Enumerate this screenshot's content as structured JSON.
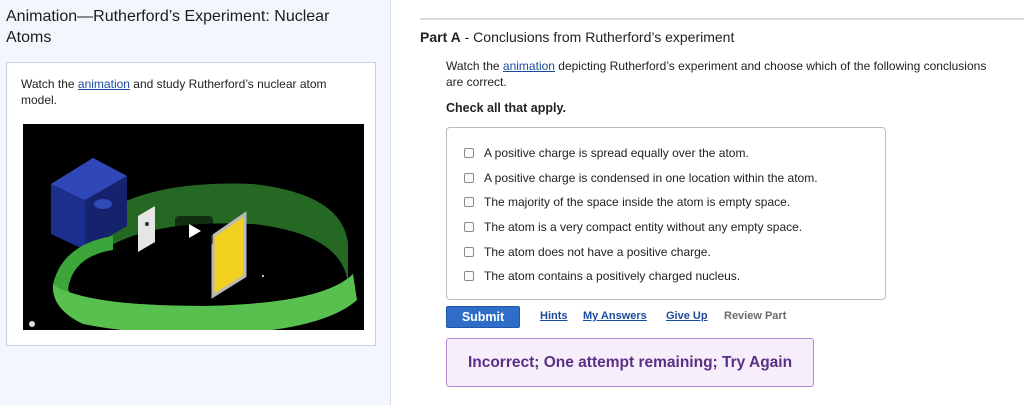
{
  "left_panel": {
    "title": "Animation—Rutherford’s Experiment: Nuclear Atoms",
    "intro": {
      "prefix": "Watch the ",
      "link": "animation",
      "suffix": " and study Rutherford’s nuclear atom model."
    },
    "video": {
      "state": "paused"
    }
  },
  "part": {
    "label": "Part A",
    "separator": " - ",
    "title": "Conclusions from Rutherford’s experiment",
    "instruction": {
      "prefix": "Watch the ",
      "link": "animation",
      "suffix": " depicting Rutherford’s experiment and choose which of the following conclusions are correct."
    },
    "check_all": "Check all that apply."
  },
  "choices": [
    {
      "label": "A positive charge is spread equally over the atom.",
      "checked": false
    },
    {
      "label": "A positive charge is condensed in one location within the atom.",
      "checked": false
    },
    {
      "label": "The majority of the space inside the atom is empty space.",
      "checked": false
    },
    {
      "label": "The atom is a very compact entity without any empty space.",
      "checked": false
    },
    {
      "label": "The atom does not have a positive charge.",
      "checked": false
    },
    {
      "label": "The atom contains a positively charged nucleus.",
      "checked": false
    }
  ],
  "actions": {
    "submit": "Submit",
    "hints": "Hints",
    "my_answers": "My Answers",
    "give_up": "Give Up",
    "review_part": "Review Part"
  },
  "feedback": "Incorrect; One attempt remaining; Try Again",
  "colors": {
    "accent": "#2e6ec8",
    "link": "#1a4a9e",
    "feedback_text": "#5b2f86",
    "feedback_bg": "#f6eefa"
  }
}
